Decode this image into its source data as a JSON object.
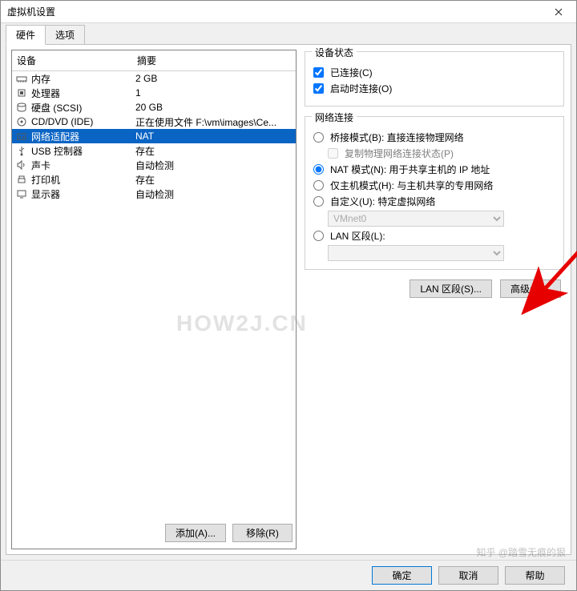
{
  "window": {
    "title": "虚拟机设置"
  },
  "tabs": {
    "hardware": "硬件",
    "options": "选项"
  },
  "list": {
    "col_device": "设备",
    "col_summary": "摘要",
    "rows": [
      {
        "icon": "memory-icon",
        "name": "内存",
        "summary": "2 GB"
      },
      {
        "icon": "cpu-icon",
        "name": "处理器",
        "summary": "1"
      },
      {
        "icon": "disk-icon",
        "name": "硬盘 (SCSI)",
        "summary": "20 GB"
      },
      {
        "icon": "cd-icon",
        "name": "CD/DVD (IDE)",
        "summary": "正在使用文件 F:\\vm\\images\\Ce..."
      },
      {
        "icon": "nic-icon",
        "name": "网络适配器",
        "summary": "NAT"
      },
      {
        "icon": "usb-icon",
        "name": "USB 控制器",
        "summary": "存在"
      },
      {
        "icon": "sound-icon",
        "name": "声卡",
        "summary": "自动检测"
      },
      {
        "icon": "printer-icon",
        "name": "打印机",
        "summary": "存在"
      },
      {
        "icon": "display-icon",
        "name": "显示器",
        "summary": "自动检测"
      }
    ],
    "add_btn": "添加(A)...",
    "remove_btn": "移除(R)"
  },
  "deviceState": {
    "legend": "设备状态",
    "connected": "已连接(C)",
    "connectAtPowerOn": "启动时连接(O)"
  },
  "netConn": {
    "legend": "网络连接",
    "bridged": "桥接模式(B): 直接连接物理网络",
    "replicate": "复制物理网络连接状态(P)",
    "nat": "NAT 模式(N): 用于共享主机的 IP 地址",
    "hostonly": "仅主机模式(H): 与主机共享的专用网络",
    "custom": "自定义(U): 特定虚拟网络",
    "vmnet_value": "VMnet0",
    "lanseg": "LAN 区段(L):"
  },
  "rightButtons": {
    "lanseg": "LAN 区段(S)...",
    "advanced": "高级(V)..."
  },
  "footer": {
    "ok": "确定",
    "cancel": "取消",
    "help": "帮助"
  },
  "watermark": "HOW2J.CN",
  "watermark2": "知乎 @踏雪无痕的狠"
}
